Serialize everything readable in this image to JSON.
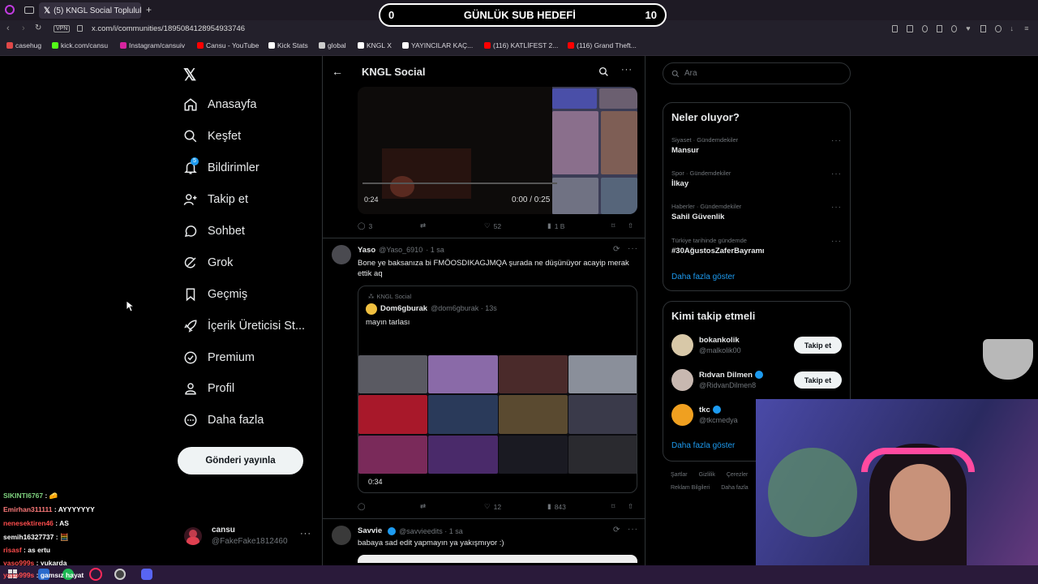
{
  "browser": {
    "tab_title": "(5) KNGL Social Topluluk / X",
    "url": "x.com/i/communities/1895084128954933746",
    "vpn": "VPN",
    "bookmarks": [
      {
        "label": "casehug",
        "color": "#e04848"
      },
      {
        "label": "kick.com/cansu",
        "color": "#53fc18"
      },
      {
        "label": "Instagram/cansuiv",
        "color": "#d6249f"
      },
      {
        "label": "Cansu - YouTube",
        "color": "#ff0000"
      },
      {
        "label": "Kick Stats",
        "color": "#ffffff"
      },
      {
        "label": "global",
        "color": "#cccccc"
      },
      {
        "label": "KNGL X",
        "color": "#ffffff"
      },
      {
        "label": "YAYINCILAR KAÇ...",
        "color": "#ffffff"
      },
      {
        "label": "(116) KATLİFEST 2...",
        "color": "#ff0000"
      },
      {
        "label": "(116) Grand Theft...",
        "color": "#ff0000"
      }
    ]
  },
  "sub_goal": {
    "left": "0",
    "title": "GÜNLÜK SUB HEDEFİ",
    "right": "10"
  },
  "nav": {
    "items": [
      {
        "label": "Anasayfa",
        "icon": "home-icon"
      },
      {
        "label": "Keşfet",
        "icon": "search-icon"
      },
      {
        "label": "Bildirimler",
        "icon": "bell-icon",
        "badge": "5"
      },
      {
        "label": "Takip et",
        "icon": "person-add-icon"
      },
      {
        "label": "Sohbet",
        "icon": "chat-icon"
      },
      {
        "label": "Grok",
        "icon": "grok-icon"
      },
      {
        "label": "Geçmiş",
        "icon": "bookmark-icon"
      },
      {
        "label": "İçerik Üreticisi St...",
        "icon": "rocket-icon"
      },
      {
        "label": "Premium",
        "icon": "premium-icon"
      },
      {
        "label": "Profil",
        "icon": "profile-icon"
      },
      {
        "label": "Daha fazla",
        "icon": "more-circle-icon"
      }
    ],
    "post_button": "Gönderi yayınla",
    "account": {
      "name": "cansu",
      "handle": "@FakeFake1812460"
    }
  },
  "header": {
    "title": "KNGL Social"
  },
  "video": {
    "elapsed": "0:24",
    "time": "0:00 / 0:25"
  },
  "tweet1_actions": {
    "replies": "3",
    "likes": "52",
    "views": "1 B"
  },
  "tweet2": {
    "name": "Yaso",
    "handle": "@Yaso_6910",
    "time": "· 1 sa",
    "text": "Bone ye baksanıza bi FMÖOSDIKAGJMQA şurada ne düşünüyor acayip merak ettik aq",
    "quote": {
      "community": "KNGL Social",
      "name": "Dom6gburak",
      "handle": "@dom6gburak · 13s",
      "text": "mayın tarlası",
      "duration": "0:34"
    },
    "likes": "12",
    "views": "843"
  },
  "tweet3": {
    "name": "Savvie",
    "handle": "@savvieedits · 1 sa",
    "text": "babaya sad edit yapmayın ya yakışmıyor :)"
  },
  "right": {
    "search_placeholder": "Ara",
    "trends_title": "Neler oluyor?",
    "trends": [
      {
        "context": "Siyaset · Gündemdekiler",
        "topic": "Mansur"
      },
      {
        "context": "Spor · Gündemdekiler",
        "topic": "İlkay"
      },
      {
        "context": "Haberler · Gündemdekiler",
        "topic": "Sahil Güvenlik"
      },
      {
        "context": "Türkiye tarihinde gündemde",
        "topic": "#30AğustosZaferBayramı"
      }
    ],
    "show_more": "Daha fazla göster",
    "who_title": "Kimi takip etmeli",
    "who": [
      {
        "name": "bokankolik",
        "handle": "@malkolik00",
        "button": "Takip et"
      },
      {
        "name": "Rıdvan Dilmen",
        "handle": "@RidvanDilmen8",
        "button": "Takip et"
      },
      {
        "name": "tkc",
        "handle": "@tkcmedya"
      }
    ],
    "who_more": "Daha fazla göster",
    "footer": [
      "Şartlar",
      "Gizlilik",
      "Çerezler",
      "Reklam Bilgileri",
      "Daha fazla"
    ]
  },
  "chat": [
    {
      "user": "SIKINTI6767",
      "msg": "🧀",
      "color": "#7fd37f"
    },
    {
      "user": "Emirhan311111",
      "msg": "AYYYYYYY",
      "color": "#ff7b7b"
    },
    {
      "user": "nenesektiren46",
      "msg": "AS",
      "color": "#ff4d4d"
    },
    {
      "user": "semih16327737",
      "msg": "🧮",
      "color": "#ffffff"
    },
    {
      "user": "risasf",
      "msg": "as ertu",
      "color": "#ff4d4d"
    },
    {
      "user": "yaso999s",
      "msg": "yukarda",
      "color": "#ff4d4d"
    },
    {
      "user": "yaso999s",
      "msg": "gamsız hayat",
      "color": "#ff4d4d"
    }
  ]
}
